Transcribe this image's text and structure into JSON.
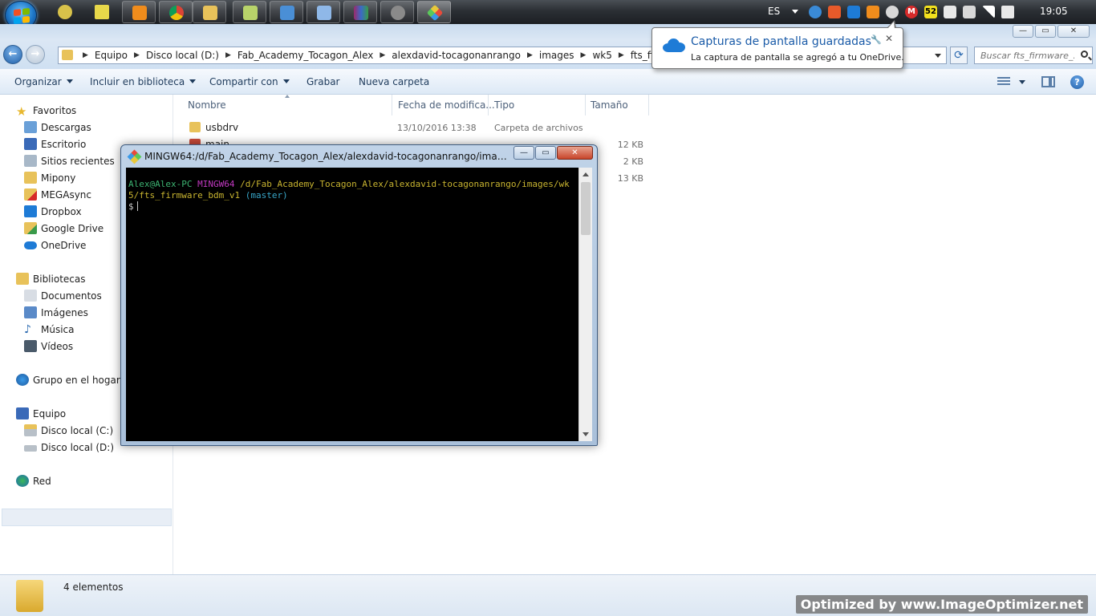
{
  "taskbar": {
    "language": "ES",
    "clock": "19:05",
    "badge_count": "52",
    "icons": [
      "start-orb",
      "media-icon",
      "app-n-icon",
      "vlc-icon",
      "chrome-icon",
      "explorer-icon",
      "folders-icon",
      "remote-desktop-icon",
      "notepad-icon",
      "winrar-icon",
      "app-icon",
      "git-icon"
    ]
  },
  "notification": {
    "title": "Capturas de pantalla guardadas",
    "body": "La captura de pantalla se agregó a tu OneDrive."
  },
  "explorer": {
    "breadcrumb": [
      "Equipo",
      "Disco local (D:)",
      "Fab_Academy_Tocagon_Alex",
      "alexdavid-tocagonanrango",
      "images",
      "wk5",
      "fts_firmware_bdm_v1"
    ],
    "search_placeholder": "Buscar fts_firmware_...",
    "toolbar": {
      "organize": "Organizar",
      "include": "Incluir en biblioteca",
      "share": "Compartir con",
      "burn": "Grabar",
      "new_folder": "Nueva carpeta"
    },
    "nav": {
      "favorites": "Favoritos",
      "downloads": "Descargas",
      "desktop": "Escritorio",
      "recent": "Sitios recientes",
      "mipony": "Mipony",
      "megasync": "MEGAsync",
      "dropbox": "Dropbox",
      "gdrive": "Google Drive",
      "onedrive": "OneDrive",
      "libraries": "Bibliotecas",
      "documents": "Documentos",
      "images": "Imágenes",
      "music": "Música",
      "videos": "Vídeos",
      "homegroup": "Grupo en el hogar",
      "computer": "Equipo",
      "disk_c": "Disco local (C:)",
      "disk_d": "Disco local (D:)",
      "network": "Red"
    },
    "columns": {
      "name": "Nombre",
      "date": "Fecha de modifica...",
      "type": "Tipo",
      "size": "Tamaño"
    },
    "files": [
      {
        "name": "usbdrv",
        "date": "13/10/2016 13:38",
        "type": "Carpeta de archivos",
        "size": ""
      },
      {
        "name": "main",
        "date": "",
        "type": "",
        "size": "12 KB"
      },
      {
        "name": "",
        "date": "",
        "type": "",
        "size": "2 KB"
      },
      {
        "name": "",
        "date": "",
        "type": "",
        "size": "13 KB"
      }
    ],
    "status": "4 elementos"
  },
  "terminal": {
    "title": "MINGW64:/d/Fab_Academy_Tocagon_Alex/alexdavid-tocagonanrango/images/wk5...",
    "user_host": "Alex@Alex-PC",
    "env": "MINGW64",
    "path": "/d/Fab_Academy_Tocagon_Alex/alexdavid-tocagonanrango/images/wk5/fts_firmware_bdm_v1",
    "branch": "(master)",
    "prompt": "$"
  },
  "watermark": "Optimized by www.ImageOptimizer.net"
}
